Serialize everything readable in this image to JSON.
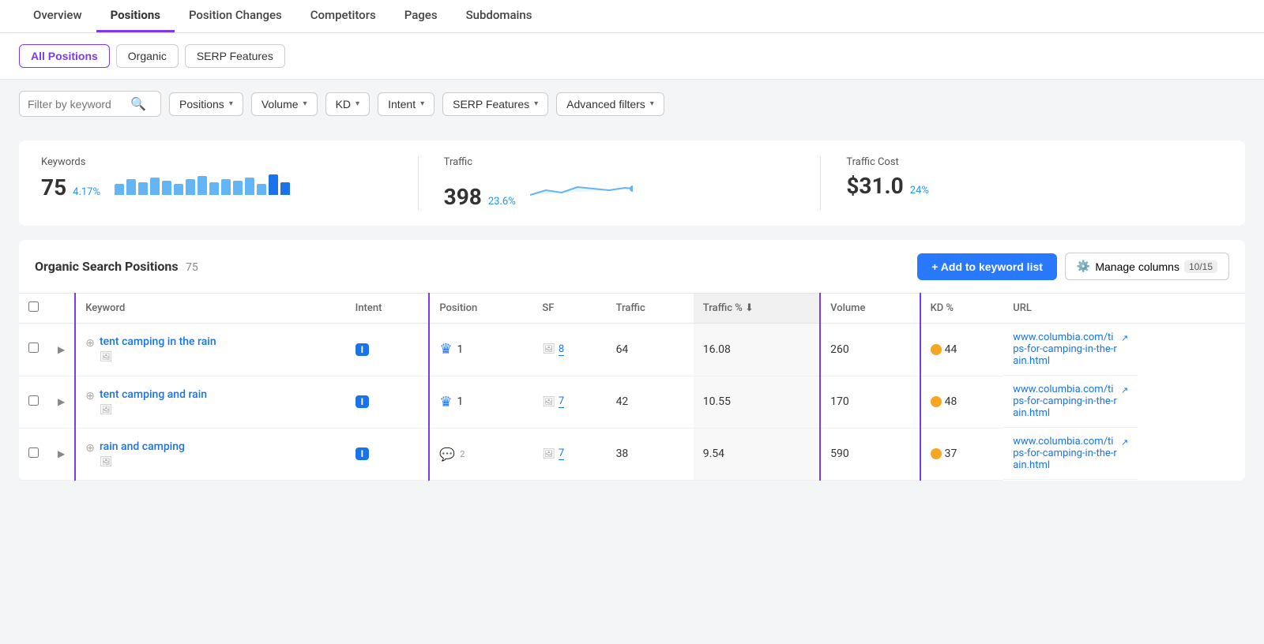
{
  "nav": {
    "tabs": [
      {
        "label": "Overview",
        "active": false
      },
      {
        "label": "Positions",
        "active": true
      },
      {
        "label": "Position Changes",
        "active": false
      },
      {
        "label": "Competitors",
        "active": false
      },
      {
        "label": "Pages",
        "active": false
      },
      {
        "label": "Subdomains",
        "active": false
      }
    ]
  },
  "subtabs": [
    {
      "label": "All Positions",
      "active": true
    },
    {
      "label": "Organic",
      "active": false
    },
    {
      "label": "SERP Features",
      "active": false
    }
  ],
  "filters": {
    "keyword_placeholder": "Filter by keyword",
    "dropdowns": [
      "Positions",
      "Volume",
      "KD",
      "Intent",
      "SERP Features",
      "Advanced filters"
    ]
  },
  "stats": {
    "keywords": {
      "label": "Keywords",
      "value": "75",
      "change": "4.17%",
      "bars": [
        8,
        12,
        10,
        14,
        11,
        9,
        13,
        15,
        10,
        12,
        11,
        14,
        9,
        16,
        10
      ]
    },
    "traffic": {
      "label": "Traffic",
      "value": "398",
      "change": "23.6%"
    },
    "traffic_cost": {
      "label": "Traffic Cost",
      "value": "$31.0",
      "change": "24%"
    }
  },
  "table": {
    "title": "Organic Search Positions",
    "count": "75",
    "add_button": "+ Add to keyword list",
    "manage_button": "Manage columns",
    "manage_badge": "10/15",
    "columns": [
      "Keyword",
      "Intent",
      "Position",
      "SF",
      "Traffic",
      "Traffic %",
      "Volume",
      "KD %",
      "URL"
    ],
    "rows": [
      {
        "keyword": "tent camping in the rain",
        "intent": "I",
        "position": "1",
        "position_type": "crown",
        "sf": "8",
        "traffic": "64",
        "traffic_pct": "16.08",
        "volume": "260",
        "kd": "44",
        "url": "www.columbia.com/tips-for-camping-in-the-rain.html"
      },
      {
        "keyword": "tent camping and rain",
        "intent": "I",
        "position": "1",
        "position_type": "crown",
        "sf": "7",
        "traffic": "42",
        "traffic_pct": "10.55",
        "volume": "170",
        "kd": "48",
        "url": "www.columbia.com/tips-for-camping-in-the-rain.html"
      },
      {
        "keyword": "rain and camping",
        "intent": "I",
        "position": "2",
        "position_type": "chat",
        "sf": "7",
        "traffic": "38",
        "traffic_pct": "9.54",
        "volume": "590",
        "kd": "37",
        "url": "www.columbia.com/tips-for-camping-in-the-rain.html"
      }
    ]
  }
}
